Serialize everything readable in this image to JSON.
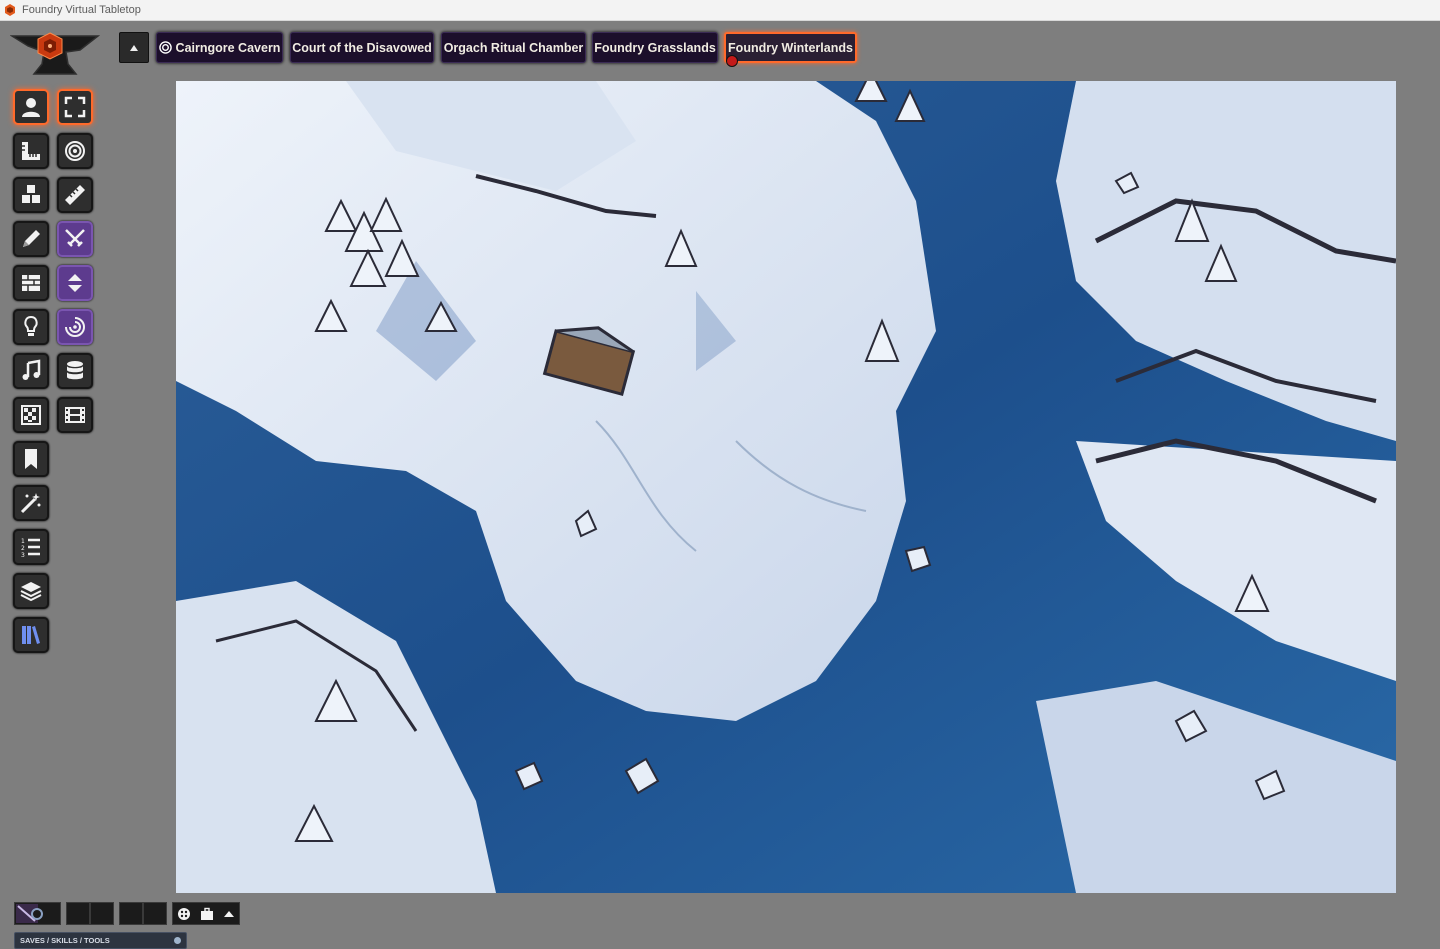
{
  "window": {
    "title": "Foundry Virtual Tabletop"
  },
  "navigation": {
    "scenes": [
      {
        "label": "Cairngore Cavern",
        "left": 0,
        "viewed": true
      },
      {
        "label": "Court of the Disavowed"
      },
      {
        "label": "Orgach Ritual Chamber"
      },
      {
        "label": "Foundry Grasslands"
      },
      {
        "label": "Foundry Winterlands",
        "active": true
      }
    ]
  },
  "controls": {
    "left_column": [
      "token-icon",
      "ruler-grid-icon",
      "cubes-icon",
      "pencil-icon",
      "wall-icon",
      "lightbulb-icon",
      "music-icon",
      "checker-icon",
      "bookmark-icon",
      "magic-wand-icon",
      "list-icon",
      "layers-icon",
      "books-icon"
    ],
    "right_column": [
      "expand-icon",
      "target-icon",
      "ruler-icon",
      "crossed-swords-icon",
      "elevation-icon",
      "swirl-target-icon",
      "database-icon",
      "film-icon"
    ]
  },
  "footer": {
    "saves_label": "SAVES / SKILLS / TOOLS"
  },
  "colors": {
    "active_border": "#ff6a2b",
    "scene_tab_bg": "#1c0f2b",
    "purple_tool": "#5d3b8e"
  }
}
